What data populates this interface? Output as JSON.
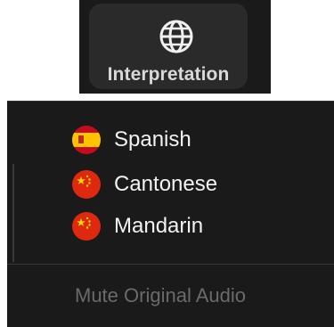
{
  "toolbar": {
    "interpretation_label": "Interpretation",
    "icon": "globe-icon"
  },
  "menu": {
    "languages": [
      {
        "label": "Spanish",
        "flag": "spain-flag-icon"
      },
      {
        "label": "Cantonese",
        "flag": "china-flag-icon"
      },
      {
        "label": "Mandarin",
        "flag": "china-flag-icon"
      }
    ],
    "mute_original_audio": "Mute Original Audio"
  },
  "colors": {
    "background": "#1a1a1a",
    "button_background": "#2a2a2a",
    "text_primary": "#f2f2f2",
    "text_disabled": "#6a6a6a",
    "spain_red": "#c60b1e",
    "spain_yellow": "#ffc400",
    "china_red": "#de2910",
    "china_star": "#ffde00"
  }
}
